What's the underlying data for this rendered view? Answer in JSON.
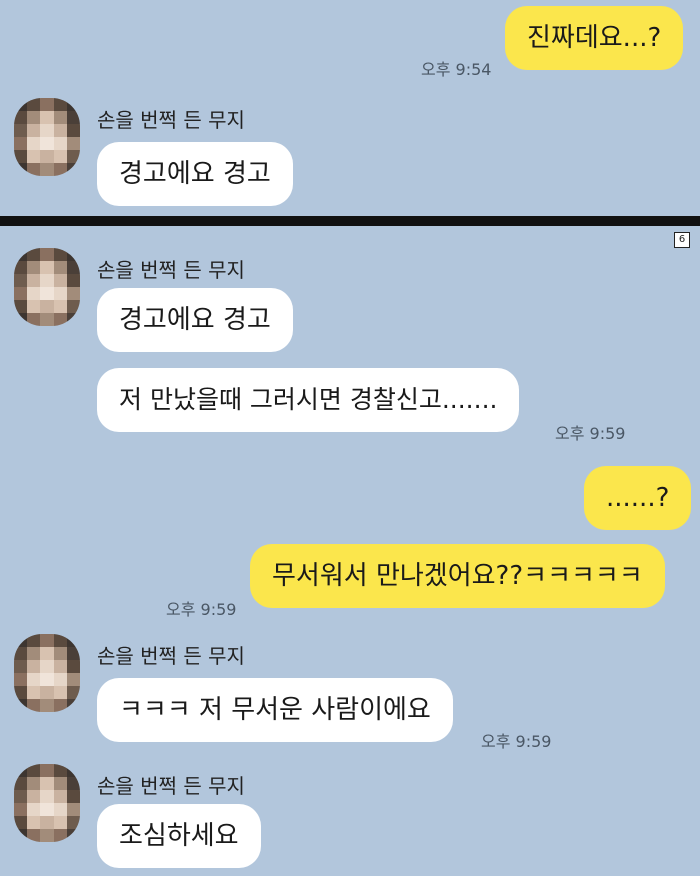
{
  "top_panel": {
    "outgoing_message": "진짜데요...?",
    "outgoing_time": "오후 9:54",
    "sender_name": "손을 번쩍 든 무지",
    "incoming_message": "경고에요 경고"
  },
  "bottom_panel": {
    "page_badge": "6",
    "groups": [
      {
        "sender_name": "손을 번쩍 든 무지",
        "messages": [
          "경고에요 경고",
          "저 만났을때 그러시면 경찰신고......."
        ],
        "time": "오후 9:59"
      },
      {
        "outgoing_messages": [
          "......?",
          "무서워서 만나겠어요??ㅋㅋㅋㅋㅋ"
        ],
        "time": "오후 9:59"
      },
      {
        "sender_name": "손을 번쩍 든 무지",
        "messages": [
          "ㅋㅋㅋ 저 무서운 사람이에요"
        ],
        "time": "오후 9:59"
      },
      {
        "sender_name": "손을 번쩍 든 무지",
        "messages": [
          "조심하세요"
        ]
      }
    ]
  },
  "colors": {
    "chat_background": "#b2c6dc",
    "incoming_bubble": "#ffffff",
    "outgoing_bubble": "#fbe64c",
    "divider": "#111111"
  },
  "icons": {
    "avatar": "pixelated-profile-avatar-icon"
  }
}
